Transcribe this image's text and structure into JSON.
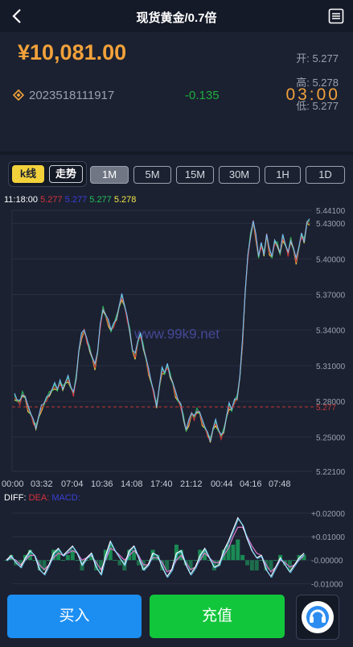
{
  "header": {
    "title": "现货黄金/0.7倍"
  },
  "summary": {
    "price": "¥10,081.00",
    "open_label": "开:",
    "open_value": "5.277",
    "high_label": "高:",
    "high_value": "5.278",
    "low_label": "低:",
    "low_value": "5.277",
    "code": "2023518111917",
    "change": "-0.135",
    "countdown": "03:00"
  },
  "tabs": {
    "chart_modes": [
      "k线",
      "走势"
    ],
    "intervals": [
      "1M",
      "5M",
      "15M",
      "30M",
      "1H",
      "1D"
    ],
    "active_interval": "1M"
  },
  "quote": {
    "time": "11:18:00",
    "v1": "5.277",
    "v2": "5.277",
    "v3": "5.277",
    "v4": "5.278"
  },
  "watermark": "www.99k9.net",
  "price_axis": [
    "5.44100",
    "5.43000",
    "5.40000",
    "5.37000",
    "5.34000",
    "5.31000",
    "5.28000",
    "5.25000",
    "5.22100"
  ],
  "current_price_label": "5.277",
  "time_axis": [
    "00:00",
    "03:32",
    "07:04",
    "10:36",
    "14:08",
    "17:40",
    "21:12",
    "00:44",
    "04:16",
    "07:48"
  ],
  "macd": {
    "diff_label": "DIFF:",
    "dea_label": "DEA:",
    "macd_label": "MACD:",
    "axis": [
      "+0.02000",
      "+0.01000",
      "-0.00000",
      "-0.01000"
    ]
  },
  "chart_data": {
    "type": "line",
    "series_price": [
      5.284,
      5.281,
      5.279,
      5.286,
      5.283,
      5.274,
      5.27,
      5.263,
      5.258,
      5.266,
      5.274,
      5.278,
      5.282,
      5.286,
      5.289,
      5.293,
      5.29,
      5.296,
      5.291,
      5.295,
      5.299,
      5.292,
      5.286,
      5.3,
      5.322,
      5.335,
      5.34,
      5.331,
      5.324,
      5.316,
      5.309,
      5.322,
      5.344,
      5.358,
      5.352,
      5.346,
      5.34,
      5.344,
      5.35,
      5.359,
      5.368,
      5.361,
      5.35,
      5.339,
      5.322,
      5.318,
      5.331,
      5.336,
      5.326,
      5.316,
      5.305,
      5.296,
      5.286,
      5.276,
      5.292,
      5.306,
      5.304,
      5.31,
      5.302,
      5.295,
      5.286,
      5.281,
      5.276,
      5.266,
      5.255,
      5.262,
      5.27,
      5.266,
      5.272,
      5.27,
      5.262,
      5.258,
      5.252,
      5.247,
      5.256,
      5.262,
      5.256,
      5.25,
      5.255,
      5.266,
      5.276,
      5.273,
      5.28,
      5.283,
      5.3,
      5.33,
      5.372,
      5.402,
      5.42,
      5.431,
      5.418,
      5.402,
      5.412,
      5.404,
      5.42,
      5.406,
      5.402,
      5.414,
      5.412,
      5.404,
      5.418,
      5.412,
      5.404,
      5.416,
      5.408,
      5.398,
      5.41,
      5.42,
      5.415,
      5.43,
      5.431
    ],
    "macd_diff": [
      0.0,
      0.002,
      -0.001,
      -0.003,
      0.001,
      0.004,
      0.002,
      -0.004,
      -0.006,
      -0.002,
      0.003,
      0.005,
      0.002,
      0.004,
      0.006,
      0.003,
      -0.002,
      0.001,
      0.003,
      -0.003,
      -0.006,
      0.002,
      0.008,
      0.004,
      0.001,
      -0.002,
      0.004,
      0.006,
      0.001,
      -0.004,
      -0.002,
      0.003,
      0.002,
      -0.003,
      -0.007,
      -0.004,
      0.003,
      0.004,
      -0.002,
      -0.006,
      -0.003,
      0.002,
      0.005,
      0.001,
      -0.003,
      -0.002,
      0.004,
      0.008,
      0.013,
      0.018,
      0.015,
      0.009,
      0.004,
      0.001,
      0.002,
      -0.004,
      -0.007,
      -0.003,
      0.001,
      -0.002,
      -0.005,
      -0.002,
      0.001,
      0.003
    ],
    "macd_dea": [
      0.0,
      0.001,
      0.0,
      -0.002,
      0.0,
      0.002,
      0.002,
      -0.002,
      -0.004,
      -0.002,
      0.001,
      0.003,
      0.002,
      0.003,
      0.004,
      0.003,
      0.0,
      0.001,
      0.002,
      -0.001,
      -0.004,
      0.0,
      0.005,
      0.004,
      0.002,
      0.0,
      0.002,
      0.004,
      0.002,
      -0.002,
      -0.002,
      0.001,
      0.001,
      -0.001,
      -0.005,
      -0.004,
      0.0,
      0.002,
      -0.001,
      -0.004,
      -0.003,
      0.0,
      0.003,
      0.001,
      -0.001,
      -0.001,
      0.002,
      0.005,
      0.01,
      0.014,
      0.014,
      0.01,
      0.006,
      0.003,
      0.002,
      -0.002,
      -0.005,
      -0.003,
      0.0,
      -0.001,
      -0.003,
      -0.002,
      0.0,
      0.002
    ]
  },
  "colors": {
    "accent": "#f2a13a",
    "up": "#1eae3c",
    "down": "#d8333c",
    "buy": "#1c8ef2",
    "recharge": "#12c63b"
  },
  "buttons": {
    "buy": "买入",
    "recharge": "充值"
  }
}
